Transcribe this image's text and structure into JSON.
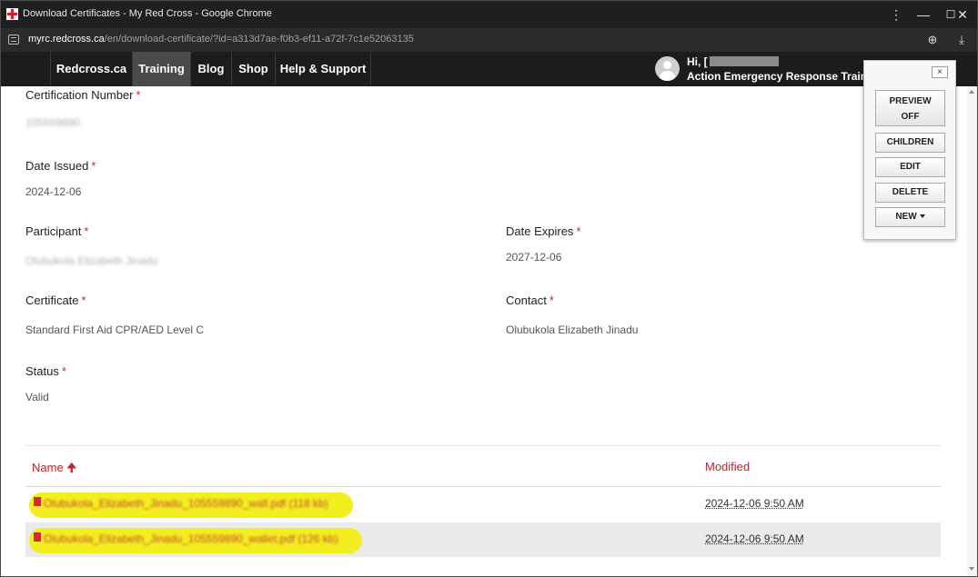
{
  "browser": {
    "window_title": "Download Certificates - My Red Cross - Google Chrome",
    "url_host": "myrc.redcross.ca",
    "url_path": "/en/download-certificate/?id=a313d7ae-f0b3-ef11-a72f-7c1e52063135"
  },
  "nav": {
    "items": [
      {
        "label": "Redcross.ca"
      },
      {
        "label": "Training",
        "active": true
      },
      {
        "label": "Blog"
      },
      {
        "label": "Shop"
      },
      {
        "label": "Help & Support"
      }
    ],
    "user_greeting": "Hi, [",
    "user_org": "Action Emergency Response Training"
  },
  "fields": {
    "certification_number": {
      "label": "Certification Number",
      "value": "105559890"
    },
    "date_issued": {
      "label": "Date Issued",
      "value": "2024-12-06"
    },
    "participant": {
      "label": "Participant",
      "value": "Olubukola Elizabeth Jinadu"
    },
    "date_expires": {
      "label": "Date Expires",
      "value": "2027-12-06"
    },
    "certificate": {
      "label": "Certificate",
      "value": "Standard First Aid CPR/AED Level C"
    },
    "contact": {
      "label": "Contact",
      "value": "Olubukola Elizabeth Jinadu"
    },
    "status": {
      "label": "Status",
      "value": "Valid"
    },
    "required_marker": "*"
  },
  "files": {
    "columns": {
      "name": "Name",
      "modified": "Modified"
    },
    "rows": [
      {
        "name": "Olubukola_Elizabeth_Jinadu_105559890_wall.pdf (118 kb)",
        "modified": "2024-12-06 9:50 AM"
      },
      {
        "name": "Olubukola_Elizabeth_Jinadu_105559890_wallet.pdf (126 kb)",
        "modified": "2024-12-06 9:50 AM"
      }
    ]
  },
  "cms_panel": {
    "close": "×",
    "preview": "PREVIEW",
    "preview_state": "OFF",
    "children": "CHILDREN",
    "edit": "EDIT",
    "delete": "DELETE",
    "new": "NEW"
  },
  "colors": {
    "accent_red": "#c8202a",
    "required_red": "#d22020",
    "highlight_yellow": "#f2ee20",
    "nav_background": "#1c1c1c"
  }
}
